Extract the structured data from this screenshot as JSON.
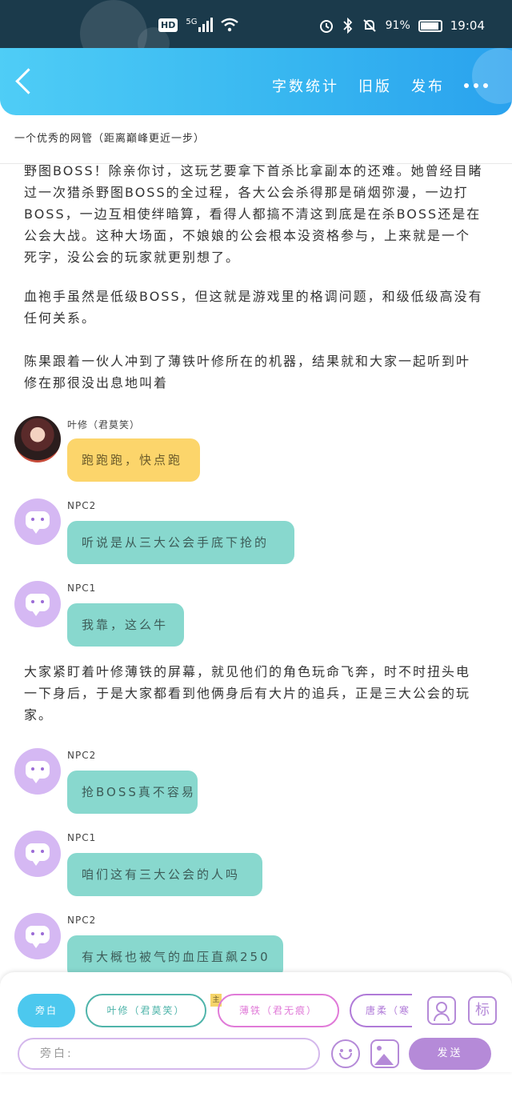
{
  "status_bar": {
    "hd": "HD",
    "network": "5G",
    "battery_percent": "91%",
    "battery_level": 0.91,
    "time": "19:04"
  },
  "header": {
    "nav": [
      "字数统计",
      "旧版",
      "发布"
    ]
  },
  "subtitle": "一个优秀的网管（距离巅峰更近一步）",
  "paragraphs": [
    "野图BOSS！除亲你讨，这玩艺要拿下首杀比拿副本的还难。她曾经目睹过一次猎杀野图BOSS的全过程，各大公会杀得那是硝烟弥漫，一边打BOSS，一边互相使绊暗算，看得人都搞不清这到底是在杀BOSS还是在公会大战。这种大场面，不娘娘的公会根本没资格参与，上来就是一个死字，没公会的玩家就更别想了。",
    "血袍手虽然是低级BOSS，但这就是游戏里的格调问题，和级低级高没有任何关系。",
    "陈果跟着一伙人冲到了薄铁叶修所在的机器，结果就和大家一起听到叶修在那很没出息地叫着",
    "大家紧盯着叶修薄铁的屏幕，就见他们的角色玩命飞奔，时不时扭头电一下身后，于是大家都看到他俩身后有大片的追兵，正是三大公会的玩家。"
  ],
  "messages": [
    {
      "speaker": "叶修（君莫笑）",
      "text": "跑跑跑，快点跑",
      "color": "yellow"
    },
    {
      "speaker": "NPC2",
      "text": "听说是从三大公会手底下抢的",
      "color": "teal"
    },
    {
      "speaker": "NPC1",
      "text": "我靠，这么牛",
      "color": "teal"
    },
    {
      "speaker": "NPC2",
      "text": "抢BOSS真不容易",
      "color": "teal"
    },
    {
      "speaker": "NPC1",
      "text": "咱们这有三大公会的人吗",
      "color": "teal"
    },
    {
      "speaker": "NPC2",
      "text": "有大概也被气的血压直飙250",
      "color": "teal"
    }
  ],
  "bottom": {
    "chips": [
      "旁白",
      "叶修（君莫笑）",
      "薄铁（君无痕）",
      "唐柔（寒"
    ],
    "tag_mark": "主",
    "label_icon": "标",
    "input_placeholder": "旁白:",
    "send_label": "发送"
  },
  "colors": {
    "header_start": "#4fcdf6",
    "header_end": "#2aa2ee",
    "bubble_teal": "#88d8ce",
    "bubble_yellow": "#fcd56b",
    "accent_purple": "#b58ad8",
    "chip_active": "#4cc8ee"
  },
  "icons": [
    "back-icon",
    "more-icon",
    "smile-icon",
    "image-icon",
    "person-icon",
    "wifi-icon",
    "alarm-icon",
    "bluetooth-icon",
    "mute-icon",
    "battery-icon"
  ]
}
